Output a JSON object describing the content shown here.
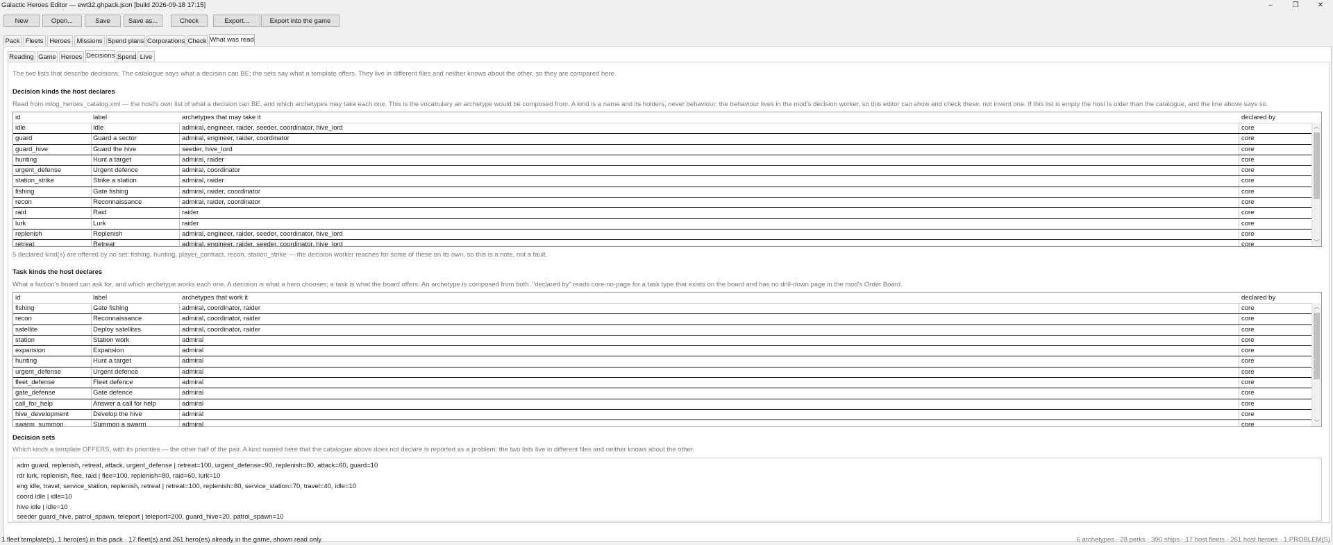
{
  "window": {
    "title": "Galactic Heroes Editor — ewt32.ghpack.json   [build 2026-09-18 17:15]",
    "minimize_glyph": "–",
    "maximize_glyph": "❐",
    "close_glyph": "✕"
  },
  "toolbar": {
    "new": "New",
    "open": "Open...",
    "save": "Save",
    "save_as": "Save as...",
    "check": "Check",
    "export": "Export...",
    "export_game": "Export into the game"
  },
  "main_tabs": [
    "Pack",
    "Fleets",
    "Heroes",
    "Missions",
    "Spend plans",
    "Corporations",
    "Check",
    "What was read"
  ],
  "sub_tabs": [
    "Reading",
    "Game",
    "Heroes",
    "Decisions",
    "Spend",
    "Live"
  ],
  "intro": "The two lists that describe decisions. The catalogue says what a decision can BE; the sets say what a template offers. They live in different files and neither knows about the other, so they are compared here.",
  "decision_kinds": {
    "heading": "Decision kinds the host declares",
    "description": "Read from mlog_heroes_catalog.xml — the host's own list of what a decision can BE, and which archetypes may take each one. This is the vocabulary an archetype would be composed from. A kind is a name and its holders, never behaviour: the behaviour lives in the mod's decision worker, so this editor can show and check these, not invent one. If this list is empty the host is older than the catalogue, and the line above says so.",
    "columns": [
      "id",
      "label",
      "archetypes that may take it",
      "declared by"
    ],
    "rows": [
      [
        "idle",
        "Idle",
        "admiral, engineer, raider, seeder, coordinator, hive_lord",
        "core"
      ],
      [
        "guard",
        "Guard a sector",
        "admiral, engineer, raider, coordinator",
        "core"
      ],
      [
        "guard_hive",
        "Guard the hive",
        "seeder, hive_lord",
        "core"
      ],
      [
        "hunting",
        "Hunt a target",
        "admiral, raider",
        "core"
      ],
      [
        "urgent_defense",
        "Urgent defence",
        "admiral, coordinator",
        "core"
      ],
      [
        "station_strike",
        "Strike a station",
        "admiral, raider",
        "core"
      ],
      [
        "fishing",
        "Gate fishing",
        "admiral, raider, coordinator",
        "core"
      ],
      [
        "recon",
        "Reconnaissance",
        "admiral, raider, coordinator",
        "core"
      ],
      [
        "raid",
        "Raid",
        "raider",
        "core"
      ],
      [
        "lurk",
        "Lurk",
        "raider",
        "core"
      ],
      [
        "replenish",
        "Replenish",
        "admiral, engineer, raider, seeder, coordinator, hive_lord",
        "core"
      ],
      [
        "retreat",
        "Retreat",
        "admiral, engineer, raider, seeder, coordinator, hive_lord",
        "core"
      ]
    ],
    "footnote": "5 declared kind(s) are offered by no set: fishing, hunting, player_contract, recon, station_strike — the decision worker reaches for some of these on its own, so this is a note, not a fault."
  },
  "task_kinds": {
    "heading": "Task kinds the host declares",
    "description": "What a faction's board can ask for, and which archetype works each one. A decision is what a hero chooses; a task is what the board offers. An archetype is composed from both. \"declared by\" reads core-no-page for a task type that exists on the board and has no drill-down page in the mod's Order Board.",
    "columns": [
      "id",
      "label",
      "archetypes that work it",
      "declared by"
    ],
    "rows": [
      [
        "fishing",
        "Gate fishing",
        "admiral, coordinator, raider",
        "core"
      ],
      [
        "recon",
        "Reconnaissance",
        "admiral, coordinator, raider",
        "core"
      ],
      [
        "satellite",
        "Deploy satellites",
        "admiral, coordinator, raider",
        "core"
      ],
      [
        "station",
        "Station work",
        "admiral",
        "core"
      ],
      [
        "expansion",
        "Expansion",
        "admiral",
        "core"
      ],
      [
        "hunting",
        "Hunt a target",
        "admiral",
        "core"
      ],
      [
        "urgent_defense",
        "Urgent defence",
        "admiral",
        "core"
      ],
      [
        "fleet_defense",
        "Fleet defence",
        "admiral",
        "core"
      ],
      [
        "gate_defense",
        "Gate defence",
        "admiral",
        "core"
      ],
      [
        "call_for_help",
        "Answer a call for help",
        "admiral",
        "core"
      ],
      [
        "hive_development",
        "Develop the hive",
        "admiral",
        "core"
      ],
      [
        "swarm_summon",
        "Summon a swarm",
        "admiral",
        "core"
      ]
    ]
  },
  "decision_sets": {
    "heading": "Decision sets",
    "description": "Which kinds a template OFFERS, with its priorities — the other half of the pair. A kind named here that the catalogue above does not declare is reported as a problem: the two lists live in different files and neither knows about the other.",
    "lines": [
      "adm   guard, replenish, retreat, attack, urgent_defense   |   retreat=100, urgent_defense=90, replenish=80, attack=60, guard=10",
      "rdr   lurk, replenish, flee, raid   |   flee=100, replenish=80, raid=60, lurk=10",
      "eng   idle, travel, service_station, replenish, retreat   |   retreat=100, replenish=80, service_station=70, travel=40, idle=10",
      "coord   idle   |   idle=10",
      "hive   idle   |   idle=10",
      "seeder   guard_hive, patrol_spawn, teleport   |   teleport=200, guard_hive=20, patrol_spawn=10"
    ]
  },
  "status": {
    "left": "1 fleet template(s), 1 hero(es) in this pack · 17 fleet(s) and 261 hero(es) already in the game, shown read only",
    "right": "6 archetypes · 28 perks · 390 ships · 17 host fleets · 261 host heroes  ·  1 PROBLEM(S)"
  }
}
